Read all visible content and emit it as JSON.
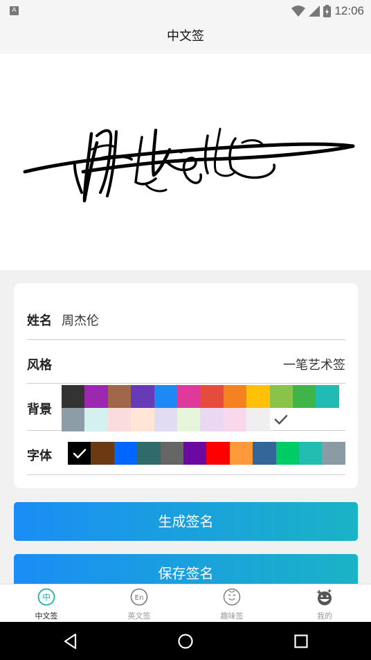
{
  "status_bar": {
    "time": "12:06",
    "app_badge": "A"
  },
  "header": {
    "title": "中文签"
  },
  "form": {
    "name_label": "姓名",
    "name_value": "周杰伦",
    "style_label": "风格",
    "style_value": "一笔艺术签",
    "background_label": "背景",
    "font_label": "字体"
  },
  "background_colors_row1": [
    "#333333",
    "#9c27b0",
    "#a0674a",
    "#673ab7",
    "#1e88f5",
    "#e0399c",
    "#e64c3c",
    "#f58220",
    "#ffc107",
    "#8bc34a",
    "#3fb449",
    "#20bcb4"
  ],
  "background_colors_row2": [
    "#8d9da8",
    "#d4f1f0",
    "#fbdcdc",
    "#ffe6d6",
    "#e1dcf2",
    "#e8f5dd",
    "#ead8f2",
    "#f8d8ea",
    "#efefef"
  ],
  "background_selected": "none / transparent (checked)",
  "font_colors": [
    "#000000",
    "#6b3a11",
    "#0066ff",
    "#2f6b6b",
    "#666666",
    "#6a0aa0",
    "#ff0000",
    "#ff9a3c",
    "#336699",
    "#00cc66",
    "#22bdb0",
    "#8b9ba5"
  ],
  "font_selected": "#000000",
  "buttons": {
    "generate": "生成签名",
    "save": "保存签名"
  },
  "tabs": [
    {
      "label": "中文签",
      "icon": "chinese-sign-icon",
      "active": true
    },
    {
      "label": "英文签",
      "icon": "english-sign-icon",
      "active": false
    },
    {
      "label": "趣味签",
      "icon": "fun-sign-icon",
      "active": false
    },
    {
      "label": "我的",
      "icon": "profile-icon",
      "active": false
    }
  ],
  "colors": {
    "accent": "#1a8df5",
    "accent_end": "#1ab3c6",
    "active_tab": "#1bb3a6"
  }
}
